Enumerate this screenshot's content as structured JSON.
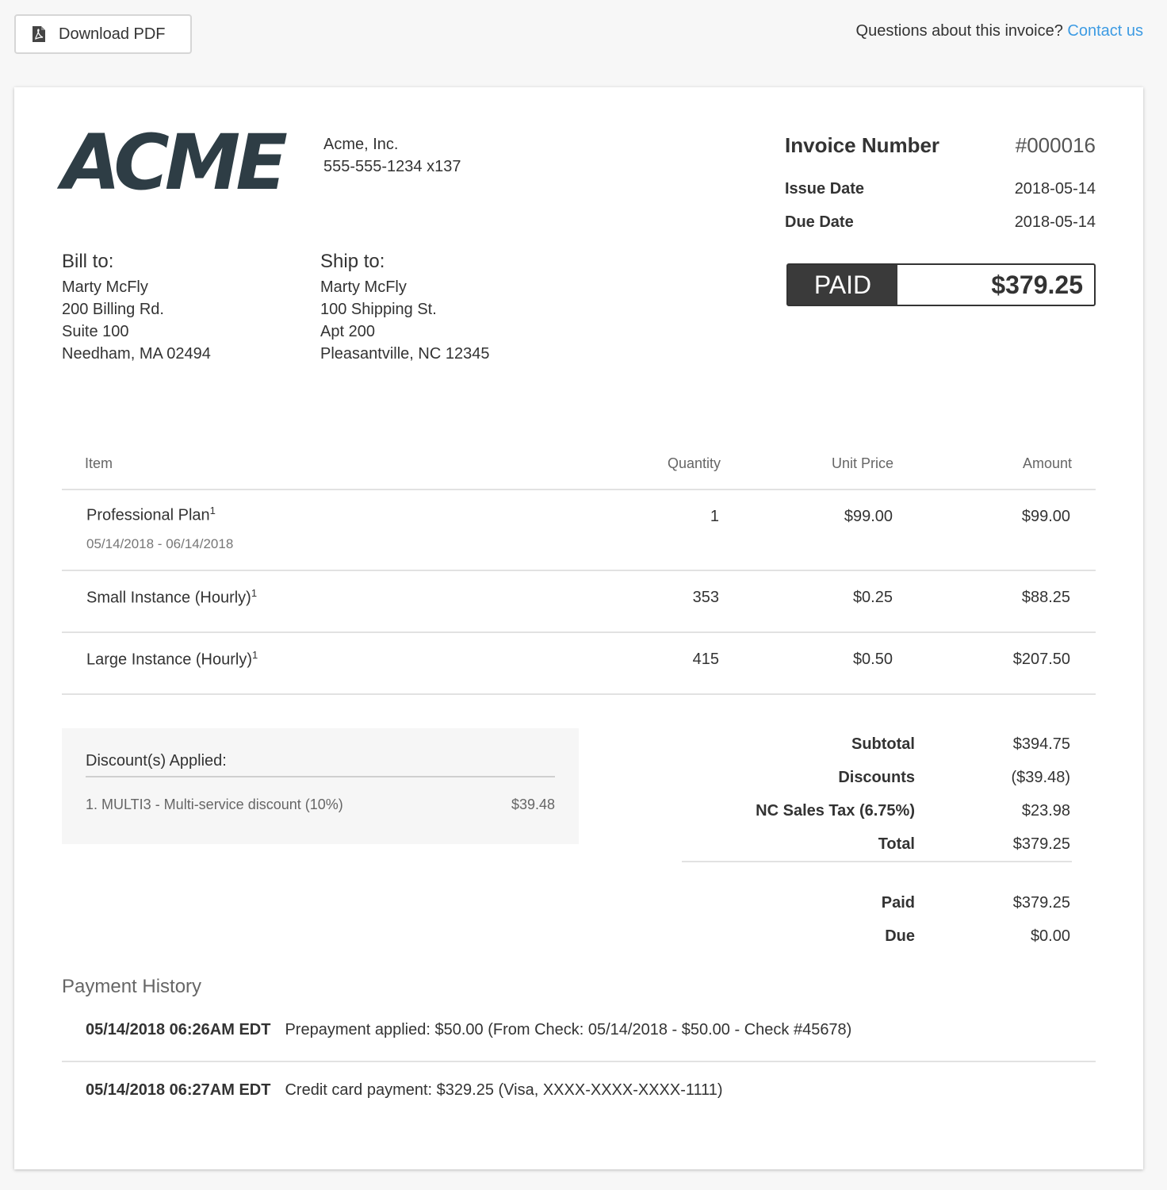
{
  "topbar": {
    "download_label": "Download PDF",
    "question_text": "Questions about this invoice?",
    "contact_label": "Contact us",
    "contact_color": "#3d9be3"
  },
  "company": {
    "logo_text": "ACME",
    "name": "Acme, Inc.",
    "phone": "555-555-1234 x137"
  },
  "invoice": {
    "number_label": "Invoice Number",
    "number": "#000016",
    "issue_label": "Issue Date",
    "issue_date": "2018-05-14",
    "due_label": "Due Date",
    "due_date": "2018-05-14",
    "status": "PAID",
    "status_amount": "$379.25"
  },
  "bill_to": {
    "title": "Bill to:",
    "lines": [
      "Marty McFly",
      "200 Billing Rd.",
      "Suite 100",
      "Needham, MA 02494"
    ]
  },
  "ship_to": {
    "title": "Ship to:",
    "lines": [
      "Marty McFly",
      "100 Shipping St.",
      "Apt 200",
      "Pleasantville, NC 12345"
    ]
  },
  "items": {
    "headers": [
      "Item",
      "Quantity",
      "Unit Price",
      "Amount"
    ],
    "rows": [
      {
        "name": "Professional Plan",
        "footnote": "1",
        "period": "05/14/2018 - 06/14/2018",
        "quantity": "1",
        "unit_price": "$99.00",
        "amount": "$99.00"
      },
      {
        "name": "Small Instance (Hourly)",
        "footnote": "1",
        "period": "",
        "quantity": "353",
        "unit_price": "$0.25",
        "amount": "$88.25"
      },
      {
        "name": "Large Instance (Hourly)",
        "footnote": "1",
        "period": "",
        "quantity": "415",
        "unit_price": "$0.50",
        "amount": "$207.50"
      }
    ]
  },
  "discounts": {
    "title": "Discount(s) Applied:",
    "items": [
      {
        "label": "1. MULTI3 - Multi-service discount (10%)",
        "amount": "$39.48"
      }
    ]
  },
  "totals": {
    "subtotal_label": "Subtotal",
    "subtotal": "$394.75",
    "discounts_label": "Discounts",
    "discounts": "($39.48)",
    "tax_label": "NC Sales Tax (6.75%)",
    "tax": "$23.98",
    "total_label": "Total",
    "total": "$379.25",
    "paid_label": "Paid",
    "paid": "$379.25",
    "due_label": "Due",
    "due": "$0.00"
  },
  "payment_history": {
    "title": "Payment History",
    "entries": [
      {
        "date": "05/14/2018 06:26AM EDT",
        "description": "Prepayment applied: $50.00 (From Check: 05/14/2018 - $50.00 - Check #45678)"
      },
      {
        "date": "05/14/2018 06:27AM EDT",
        "description": "Credit card payment: $329.25 (Visa, XXXX-XXXX-XXXX-1111)"
      }
    ]
  }
}
